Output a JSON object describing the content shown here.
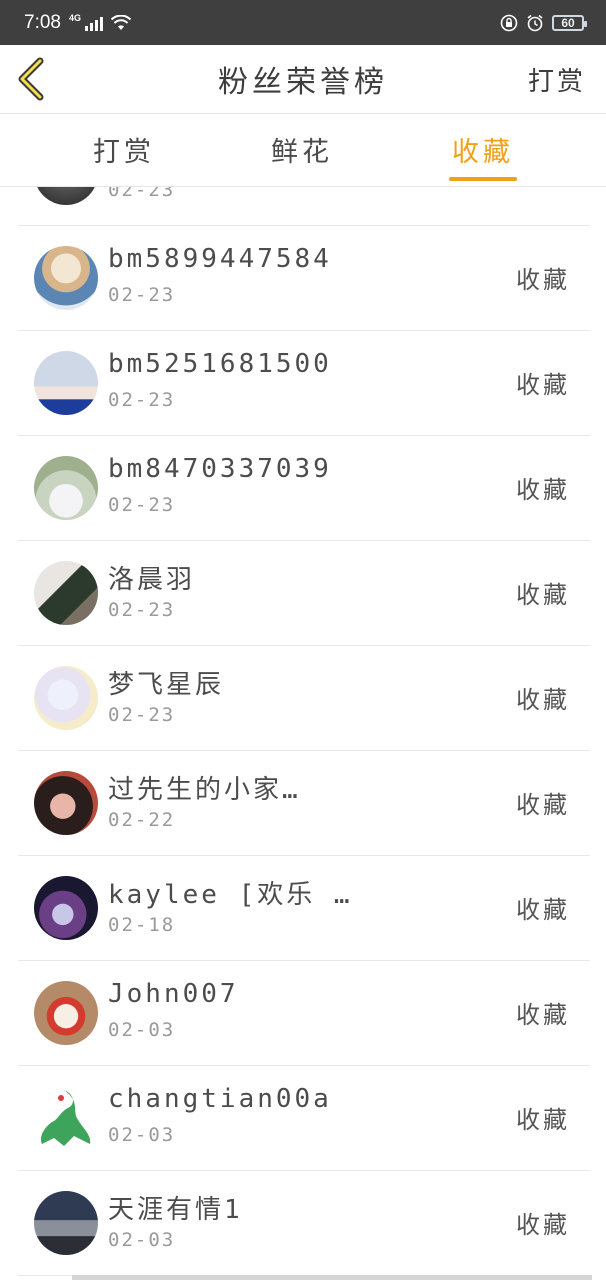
{
  "status_bar": {
    "time": "7:08",
    "network": "4G",
    "battery": "60"
  },
  "header": {
    "title": "粉丝荣誉榜",
    "action_label": "打赏"
  },
  "tabs": [
    {
      "label": "打赏",
      "active": false
    },
    {
      "label": "鲜花",
      "active": false
    },
    {
      "label": "收藏",
      "active": true
    }
  ],
  "colors": {
    "accent": "#f0a11a",
    "status_bar": "#3f3f3f"
  },
  "list": {
    "partial_row_date": "02-23",
    "rows": [
      {
        "name": "bm5899447584",
        "date": "02-23",
        "action": "收藏"
      },
      {
        "name": "bm5251681500",
        "date": "02-23",
        "action": "收藏"
      },
      {
        "name": "bm8470337039",
        "date": "02-23",
        "action": "收藏"
      },
      {
        "name": "洛晨羽",
        "date": "02-23",
        "action": "收藏"
      },
      {
        "name": "梦飞星辰",
        "date": "02-23",
        "action": "收藏"
      },
      {
        "name": "过先生的小家…",
        "date": "02-22",
        "action": "收藏"
      },
      {
        "name": "kaylee [欢乐 …",
        "date": "02-18",
        "action": "收藏"
      },
      {
        "name": "John007",
        "date": "02-03",
        "action": "收藏"
      },
      {
        "name": "changtian00a",
        "date": "02-03",
        "action": "收藏"
      },
      {
        "name": "天涯有情1",
        "date": "02-03",
        "action": "收藏"
      }
    ]
  }
}
